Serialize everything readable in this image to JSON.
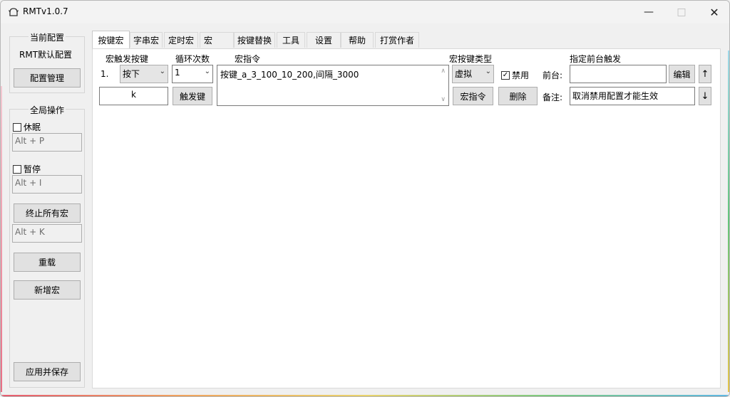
{
  "window": {
    "title": "RMTv1.0.7"
  },
  "left": {
    "current_config_title": "当前配置",
    "current_config_value": "RMT默认配置",
    "config_manage_button": "配置管理",
    "global_ops_title": "全局操作",
    "sleep_label": "休眠",
    "sleep_hotkey": "Alt + P",
    "pause_label": "暂停",
    "pause_hotkey": "Alt + I",
    "stop_all_button": "终止所有宏",
    "stop_all_hotkey": "Alt + K",
    "reload_button": "重载",
    "add_macro_button": "新增宏",
    "apply_save_button": "应用并保存"
  },
  "tabs": [
    "按键宏",
    "字串宏",
    "定时宏",
    "宏",
    "按键替换",
    "工具",
    "设置",
    "帮助",
    "打赏作者"
  ],
  "active_tab": 0,
  "macro": {
    "header_trigger_key": "宏触发按键",
    "header_loop_count": "循环次数",
    "header_command": "宏指令",
    "header_type": "宏按键类型",
    "header_foreground": "指定前台触发",
    "row_index": "1.",
    "trigger_mode": "按下",
    "loop_count": "1",
    "command_text": "按键_a_3_100_10_200,间隔_3000",
    "type_value": "虚拟",
    "disable_label": "禁用",
    "foreground_label": "前台:",
    "foreground_value": "",
    "edit_button": "编辑",
    "up_button": "↑",
    "key_value": "k",
    "trigger_key_button": "触发键",
    "macro_cmd_button": "宏指令",
    "delete_button": "删除",
    "note_label": "备注:",
    "note_value": "取消禁用配置才能生效",
    "down_button": "↓"
  }
}
